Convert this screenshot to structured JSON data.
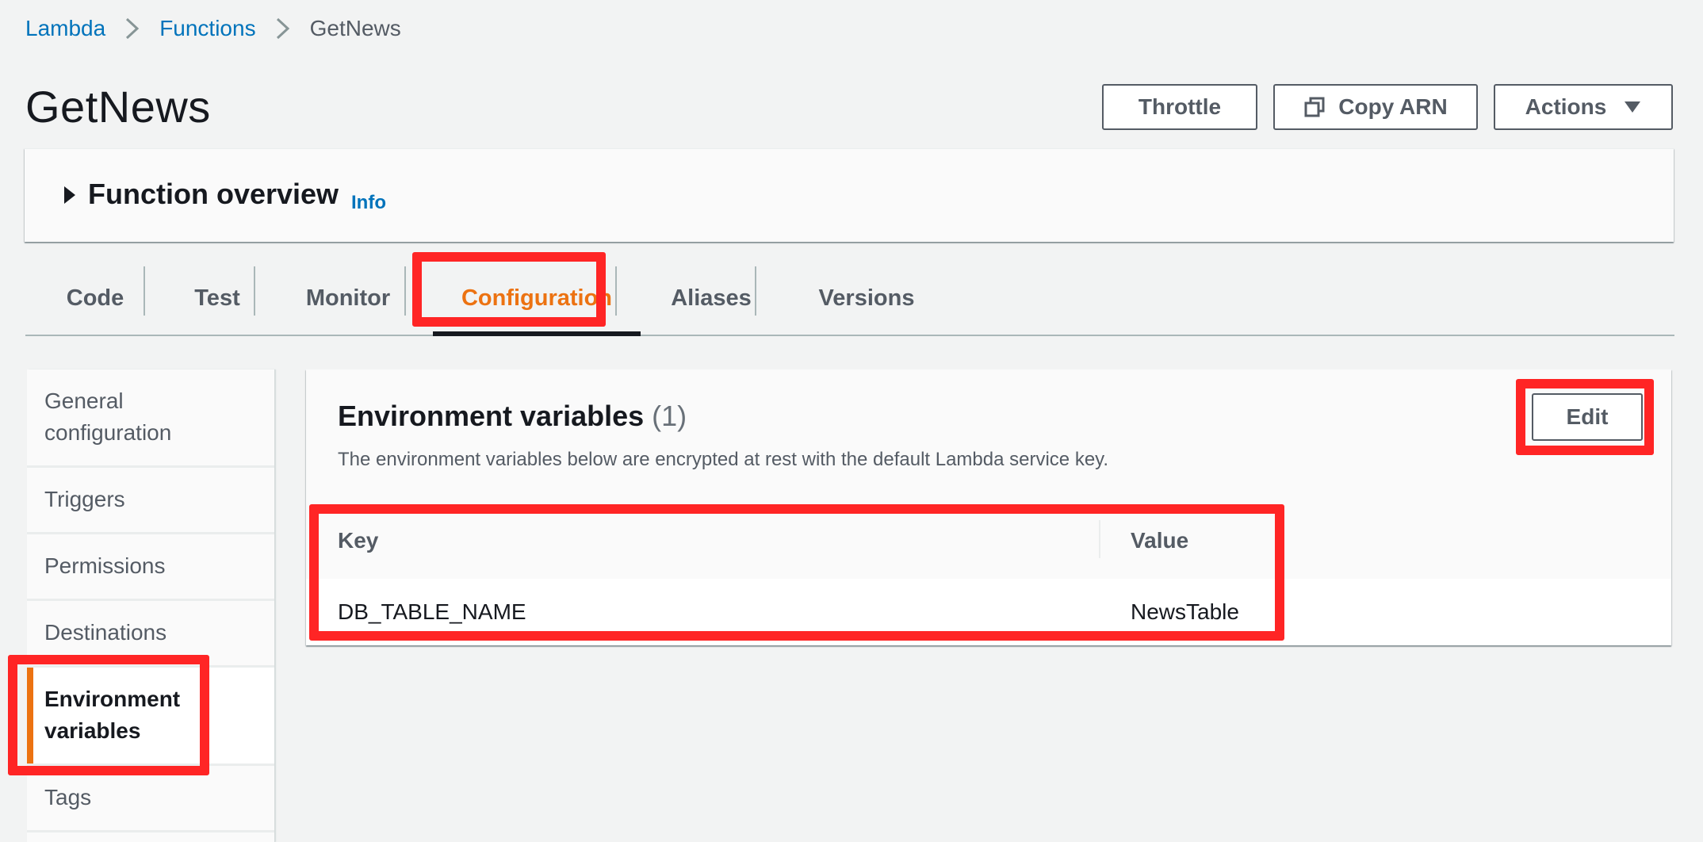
{
  "breadcrumb": {
    "items": [
      "Lambda",
      "Functions",
      "GetNews"
    ]
  },
  "page": {
    "title": "GetNews"
  },
  "header_buttons": {
    "throttle": "Throttle",
    "copy_arn": "Copy ARN",
    "actions": "Actions"
  },
  "overview": {
    "title": "Function overview",
    "info": "Info"
  },
  "tabs": [
    "Code",
    "Test",
    "Monitor",
    "Configuration",
    "Aliases",
    "Versions"
  ],
  "active_tab": "Configuration",
  "sidenav": {
    "items": [
      "General configuration",
      "Triggers",
      "Permissions",
      "Destinations",
      "Environment variables",
      "Tags"
    ],
    "active": "Environment variables"
  },
  "env_panel": {
    "title": "Environment variables",
    "count": "(1)",
    "description": "The environment variables below are encrypted at rest with the default Lambda service key.",
    "edit_label": "Edit",
    "columns": [
      "Key",
      "Value"
    ],
    "rows": [
      {
        "key": "DB_TABLE_NAME",
        "value": "NewsTable"
      }
    ]
  },
  "colors": {
    "accent_orange": "#ec7211",
    "link_blue": "#0073bb",
    "highlight_red": "#ff2525"
  }
}
